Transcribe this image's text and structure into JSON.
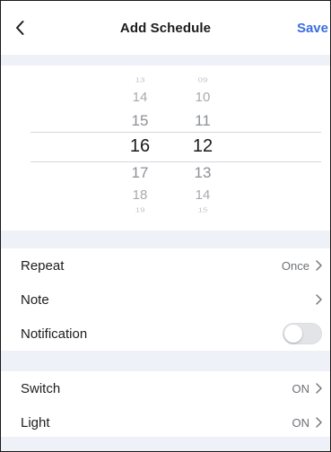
{
  "header": {
    "title": "Add Schedule",
    "save_label": "Save",
    "back_icon": "chevron-left-icon"
  },
  "picker": {
    "hours": [
      "13",
      "14",
      "15",
      "16",
      "17",
      "18",
      "19"
    ],
    "minutes": [
      "09",
      "10",
      "11",
      "12",
      "13",
      "14",
      "15"
    ],
    "selected_hour": "16",
    "selected_minute": "12"
  },
  "settings": {
    "repeat": {
      "label": "Repeat",
      "value": "Once"
    },
    "note": {
      "label": "Note",
      "value": ""
    },
    "notification": {
      "label": "Notification",
      "enabled": false
    }
  },
  "actions": {
    "switch": {
      "label": "Switch",
      "value": "ON"
    },
    "light": {
      "label": "Light",
      "value": "ON"
    }
  },
  "colors": {
    "accent": "#3a6ee0",
    "background": "#eef1f7",
    "card": "#ffffff"
  }
}
